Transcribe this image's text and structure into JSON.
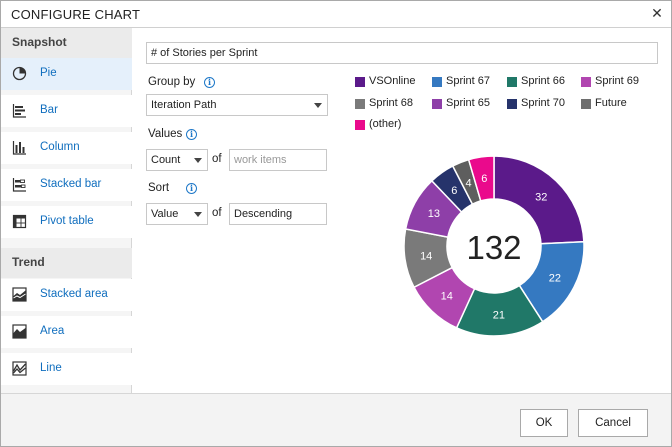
{
  "dialog": {
    "title": "CONFIGURE CHART",
    "close_glyph": "✕"
  },
  "sidebar": {
    "snapshot_header": "Snapshot",
    "trend_header": "Trend",
    "snapshot_items": [
      {
        "label": "Pie",
        "icon": "pie-chart-icon",
        "active": true
      },
      {
        "label": "Bar",
        "icon": "bar-chart-icon"
      },
      {
        "label": "Column",
        "icon": "column-chart-icon"
      },
      {
        "label": "Stacked bar",
        "icon": "stacked-bar-icon"
      },
      {
        "label": "Pivot table",
        "icon": "pivot-table-icon"
      }
    ],
    "trend_items": [
      {
        "label": "Stacked area",
        "icon": "stacked-area-icon"
      },
      {
        "label": "Area",
        "icon": "area-chart-icon"
      },
      {
        "label": "Line",
        "icon": "line-chart-icon"
      }
    ]
  },
  "form": {
    "chart_title": "# of Stories per Sprint",
    "group_by_label": "Group by",
    "group_by_value": "Iteration Path",
    "values_label": "Values",
    "values_aggregate": "Count",
    "of_label": "of",
    "values_field_placeholder": "work items",
    "sort_label": "Sort",
    "sort_by": "Value",
    "sort_order": "Descending",
    "info_glyph": "i"
  },
  "legend": [
    {
      "name": "VSOnline",
      "color": "#5b1a8a"
    },
    {
      "name": "Sprint 67",
      "color": "#3579c1"
    },
    {
      "name": "Sprint 66",
      "color": "#207868"
    },
    {
      "name": "Sprint 69",
      "color": "#b146b0"
    },
    {
      "name": "Sprint 68",
      "color": "#7a7a7a"
    },
    {
      "name": "Sprint 65",
      "color": "#8e3fa8"
    },
    {
      "name": "Sprint 70",
      "color": "#26336b"
    },
    {
      "name": "Future",
      "color": "#6e6e6e"
    },
    {
      "name": "(other)",
      "color": "#ea0a8c"
    }
  ],
  "chart_data": {
    "type": "pie",
    "total_label": "132",
    "categories": [
      "VSOnline",
      "Sprint 67",
      "Sprint 66",
      "Sprint 69",
      "Sprint 68",
      "Sprint 65",
      "Sprint 70",
      "Future",
      "(other)"
    ],
    "values": [
      32,
      22,
      21,
      14,
      14,
      13,
      6,
      4,
      6
    ],
    "colors": [
      "#5b1a8a",
      "#3579c1",
      "#207868",
      "#b146b0",
      "#7a7a7a",
      "#8e3fa8",
      "#26336b",
      "#5e5e5e",
      "#ea0a8c"
    ],
    "donut": true,
    "legend_position": "top"
  },
  "footer": {
    "ok_label": "OK",
    "cancel_label": "Cancel"
  }
}
